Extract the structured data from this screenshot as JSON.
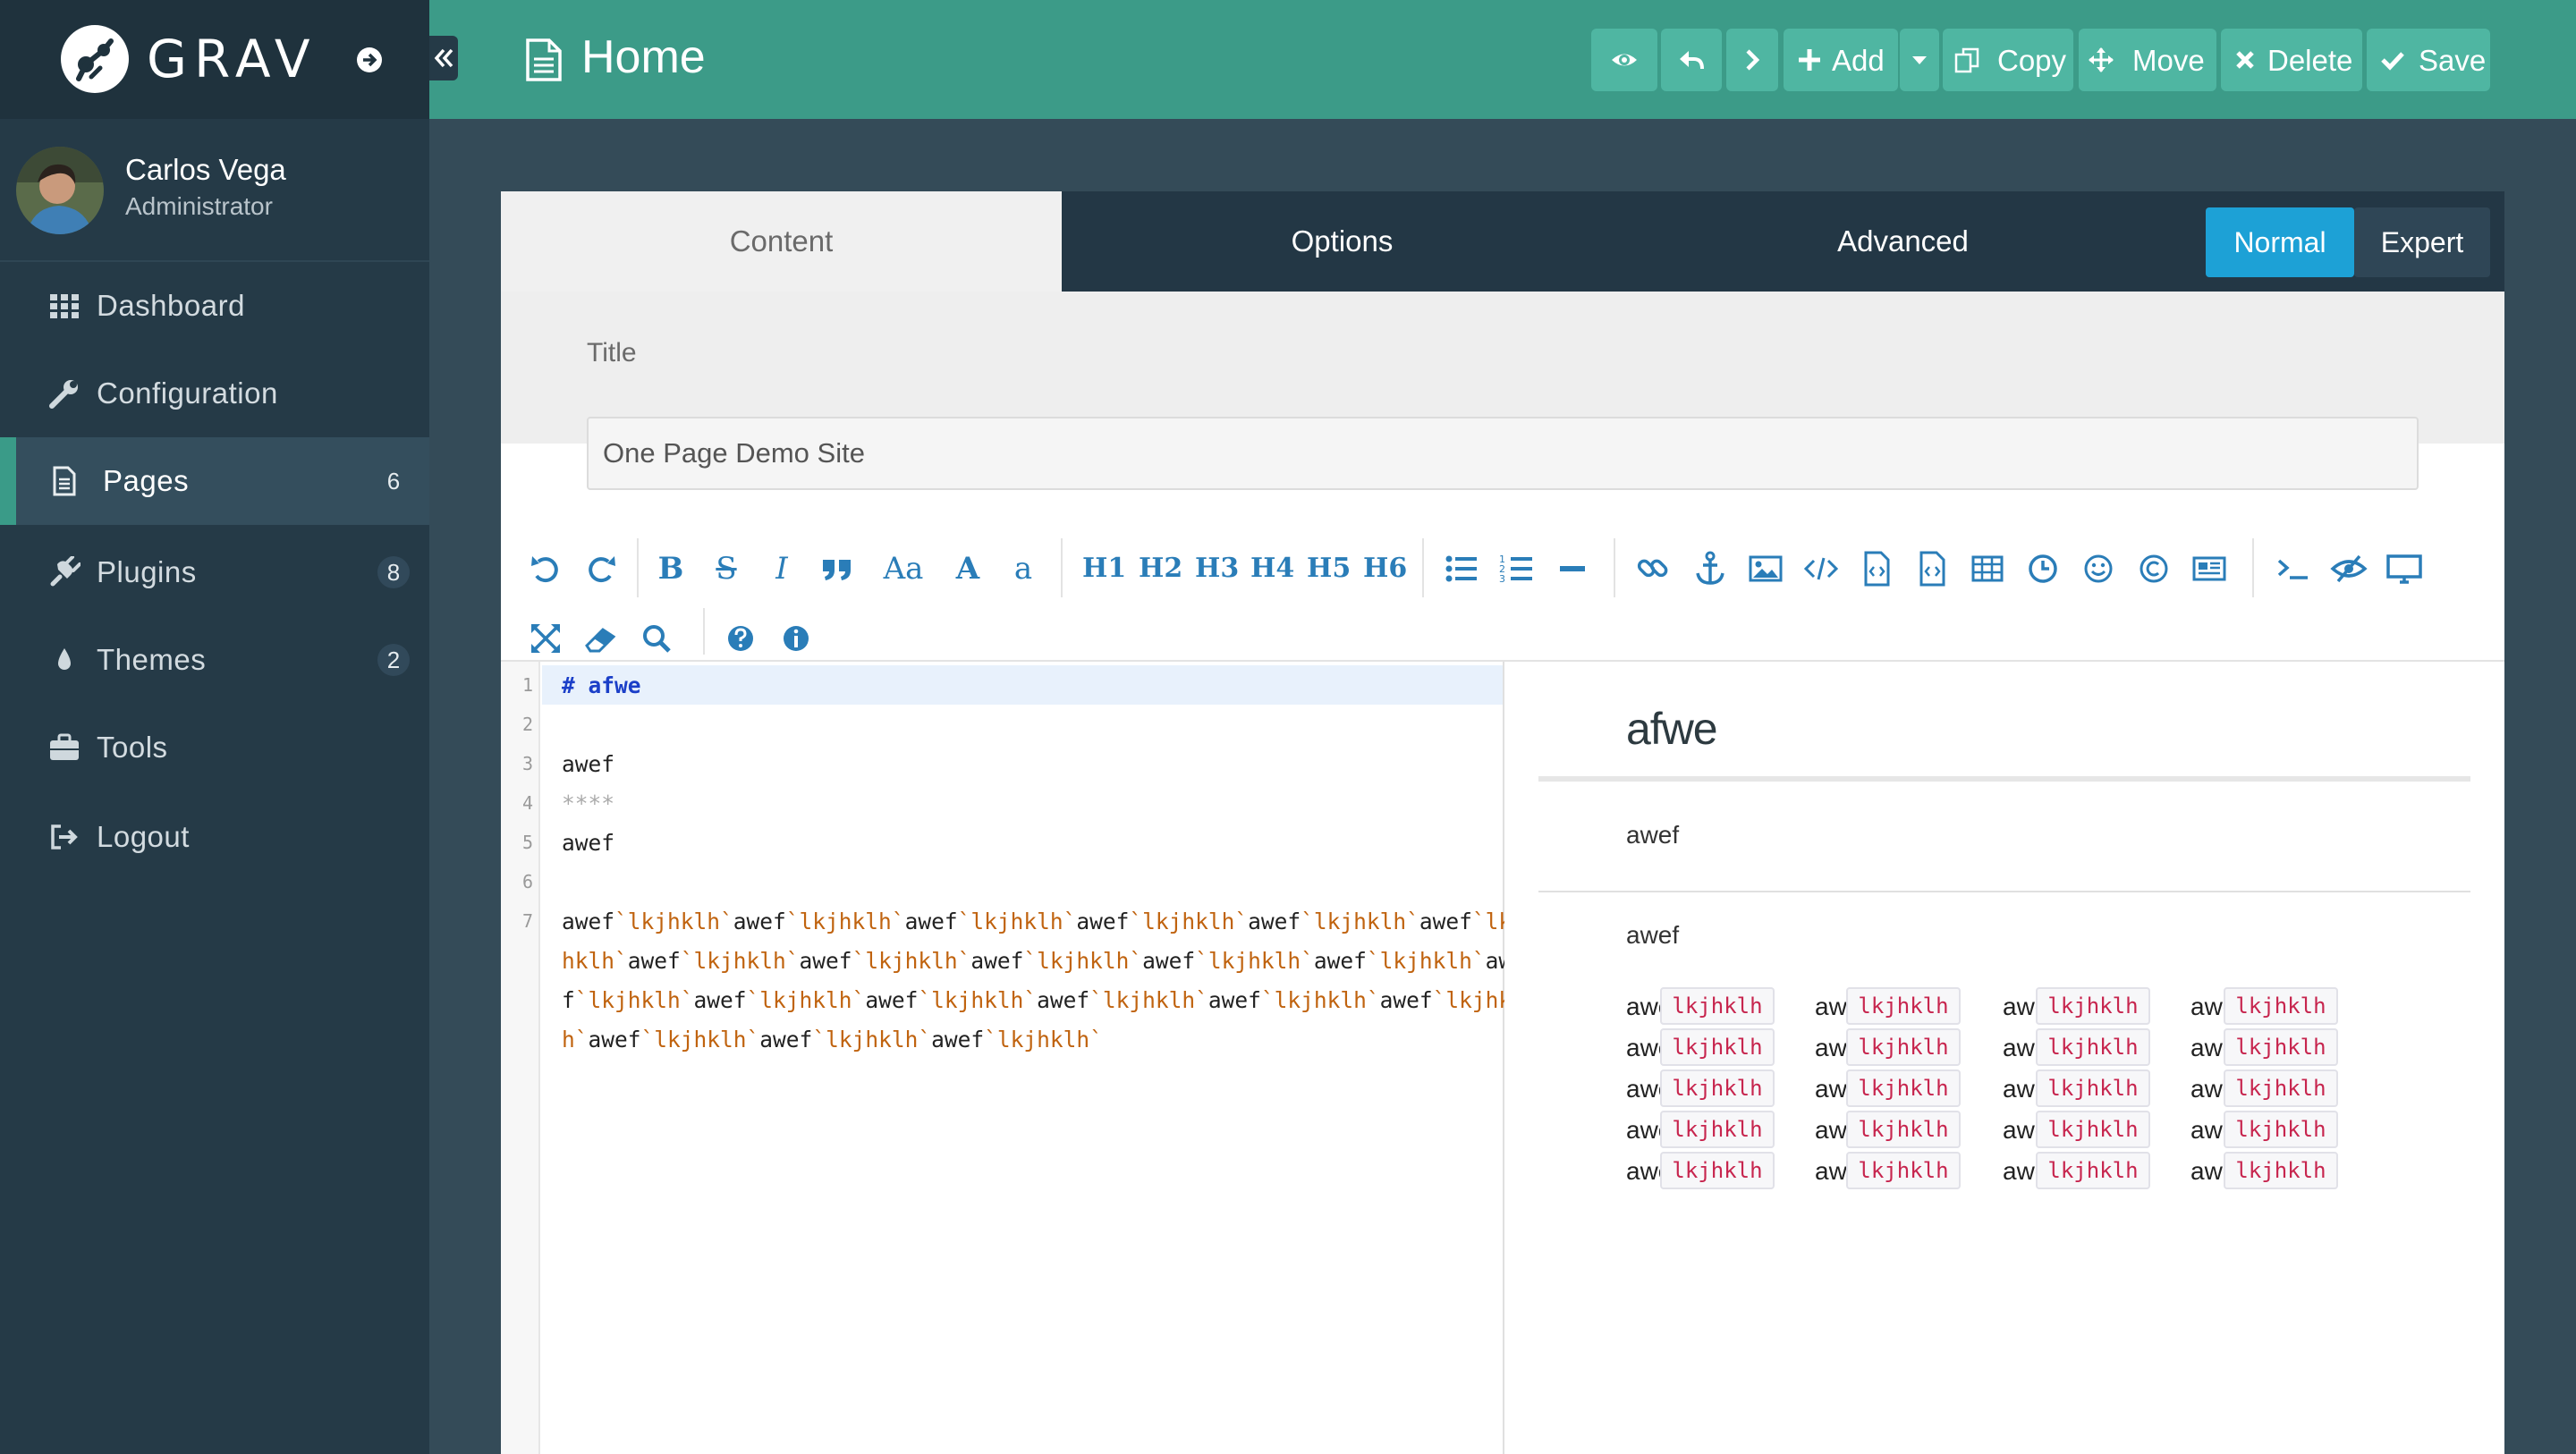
{
  "brand": {
    "name": "GRAV"
  },
  "user": {
    "name": "Carlos Vega",
    "role": "Administrator"
  },
  "nav": [
    {
      "label": "Dashboard",
      "icon": "grid-icon",
      "badge": ""
    },
    {
      "label": "Configuration",
      "icon": "wrench-icon",
      "badge": ""
    },
    {
      "label": "Pages",
      "icon": "file-icon",
      "badge": "6",
      "active": true
    },
    {
      "label": "Plugins",
      "icon": "plug-icon",
      "badge": "8"
    },
    {
      "label": "Themes",
      "icon": "tint-icon",
      "badge": "2"
    },
    {
      "label": "Tools",
      "icon": "briefcase-icon",
      "badge": ""
    },
    {
      "label": "Logout",
      "icon": "sign-out-icon",
      "badge": ""
    }
  ],
  "header": {
    "page_title": "Home",
    "buttons": {
      "add": "Add",
      "copy": "Copy",
      "move": "Move",
      "delete": "Delete",
      "save": "Save"
    }
  },
  "tabs": {
    "content": "Content",
    "options": "Options",
    "advanced": "Advanced"
  },
  "mode": {
    "normal": "Normal",
    "expert": "Expert",
    "selected": "Normal"
  },
  "title_field": {
    "label": "Title",
    "value": "One Page Demo Site"
  },
  "toolbar": {
    "headings": [
      "H1",
      "H2",
      "H3",
      "H4",
      "H5",
      "H6"
    ],
    "font_size": "Aa",
    "font_big": "A",
    "font_small": "a"
  },
  "editor": {
    "line_numbers": [
      "1",
      "2",
      "3",
      "4",
      "5",
      "6",
      "7"
    ],
    "lines": {
      "l1": "# afwe",
      "l3": "awef",
      "l4": "****",
      "l5": "awef"
    },
    "wrapped": [
      [
        [
          "t",
          "awef"
        ],
        [
          "k",
          "`lkjhklh`"
        ],
        [
          "t",
          "awef"
        ],
        [
          "k",
          "`lkjhklh`"
        ],
        [
          "t",
          "awef"
        ],
        [
          "k",
          "`lkjhklh`"
        ],
        [
          "t",
          "awef"
        ],
        [
          "k",
          "`lkjhklh`"
        ],
        [
          "t",
          "awef"
        ],
        [
          "k",
          "`lkjhklh`"
        ],
        [
          "t",
          "awef"
        ],
        [
          "k",
          "`lkj"
        ]
      ],
      [
        [
          "k",
          "hklh`"
        ],
        [
          "t",
          "awef"
        ],
        [
          "k",
          "`lkjhklh`"
        ],
        [
          "t",
          "awef"
        ],
        [
          "k",
          "`lkjhklh`"
        ],
        [
          "t",
          "awef"
        ],
        [
          "k",
          "`lkjhklh`"
        ],
        [
          "t",
          "awef"
        ],
        [
          "k",
          "`lkjhklh`"
        ],
        [
          "t",
          "awef"
        ],
        [
          "k",
          "`lkjhklh`"
        ],
        [
          "t",
          "awe"
        ]
      ],
      [
        [
          "t",
          "f"
        ],
        [
          "k",
          "`lkjhklh`"
        ],
        [
          "t",
          "awef"
        ],
        [
          "k",
          "`lkjhklh`"
        ],
        [
          "t",
          "awef"
        ],
        [
          "k",
          "`lkjhklh`"
        ],
        [
          "t",
          "awef"
        ],
        [
          "k",
          "`lkjhklh`"
        ],
        [
          "t",
          "awef"
        ],
        [
          "k",
          "`lkjhklh`"
        ],
        [
          "t",
          "awef"
        ],
        [
          "k",
          "`lkjhkl"
        ]
      ],
      [
        [
          "k",
          "h`"
        ],
        [
          "t",
          "awef"
        ],
        [
          "k",
          "`lkjhklh`"
        ],
        [
          "t",
          "awef"
        ],
        [
          "k",
          "`lkjhklh`"
        ],
        [
          "t",
          "awef"
        ],
        [
          "k",
          "`lkjhklh`"
        ]
      ]
    ]
  },
  "preview": {
    "heading": "afwe",
    "para1": "awef",
    "para2": "awef",
    "rows": [
      [
        "awef",
        "lkjhklh",
        "awef",
        "lkjhklh",
        "awef",
        "lkjhklh",
        "awef",
        "lkjhklh"
      ],
      [
        "awef",
        "lkjhklh",
        "awef",
        "lkjhklh",
        "awef",
        "lkjhklh",
        "awef",
        "lkjhklh"
      ],
      [
        "awef",
        "lkjhklh",
        "awef",
        "lkjhklh",
        "awef",
        "lkjhklh",
        "awef",
        "lkjhklh"
      ],
      [
        "awef",
        "lkjhklh",
        "awef",
        "lkjhklh",
        "awef",
        "lkjhklh",
        "awef",
        "lkjhklh"
      ],
      [
        "awef",
        "lkjhklh",
        "awef",
        "lkjhklh",
        "awef",
        "lkjhklh",
        "awef",
        "lkjhklh"
      ]
    ]
  },
  "colors": {
    "header": "#3c9b88",
    "sidebar": "#253a47",
    "accent": "#1da1d6",
    "tool": "#2a7db8",
    "code_inline": "#c7254e"
  }
}
